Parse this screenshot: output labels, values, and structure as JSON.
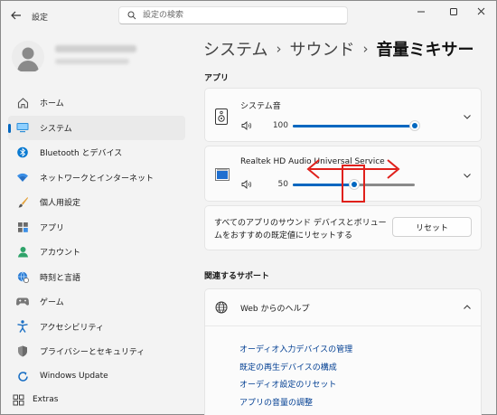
{
  "window": {
    "app_title": "設定",
    "minimize": "minimize",
    "maximize": "maximize",
    "close": "close"
  },
  "search": {
    "placeholder": "設定の検索"
  },
  "nav": {
    "items": [
      {
        "label": "ホーム",
        "icon": "home-icon"
      },
      {
        "label": "システム",
        "icon": "system-icon",
        "active": true
      },
      {
        "label": "Bluetooth とデバイス",
        "icon": "bluetooth-icon"
      },
      {
        "label": "ネットワークとインターネット",
        "icon": "network-icon"
      },
      {
        "label": "個人用設定",
        "icon": "brush-icon"
      },
      {
        "label": "アプリ",
        "icon": "apps-icon"
      },
      {
        "label": "アカウント",
        "icon": "account-icon"
      },
      {
        "label": "時刻と言語",
        "icon": "globe-clock-icon"
      },
      {
        "label": "ゲーム",
        "icon": "gamepad-icon"
      },
      {
        "label": "アクセシビリティ",
        "icon": "accessibility-icon"
      },
      {
        "label": "プライバシーとセキュリティ",
        "icon": "shield-icon"
      },
      {
        "label": "Windows Update",
        "icon": "update-icon"
      }
    ],
    "extras": "Extras"
  },
  "breadcrumb": {
    "part1": "システム",
    "part2": "サウンド",
    "current": "音量ミキサー",
    "separator": "›"
  },
  "apps_section": {
    "heading": "アプリ",
    "apps": [
      {
        "name": "システム音",
        "volume": 100,
        "volume_text": "100"
      },
      {
        "name": "Realtek HD Audio Universal Service",
        "volume": 50,
        "volume_text": "50"
      }
    ],
    "reset_text": "すべてのアプリのサウンド デバイスとボリュームをおすすめの既定値にリセットする",
    "reset_button": "リセット"
  },
  "related": {
    "heading": "関連するサポート",
    "help_title": "Web からのヘルプ",
    "links": [
      "オーディオ入力デバイスの管理",
      "既定の再生デバイスの構成",
      "オーディオ設定のリセット",
      "アプリの音量の調整"
    ]
  },
  "colors": {
    "accent": "#0067c0",
    "annotation": "#e0201b",
    "link": "#003e92"
  }
}
